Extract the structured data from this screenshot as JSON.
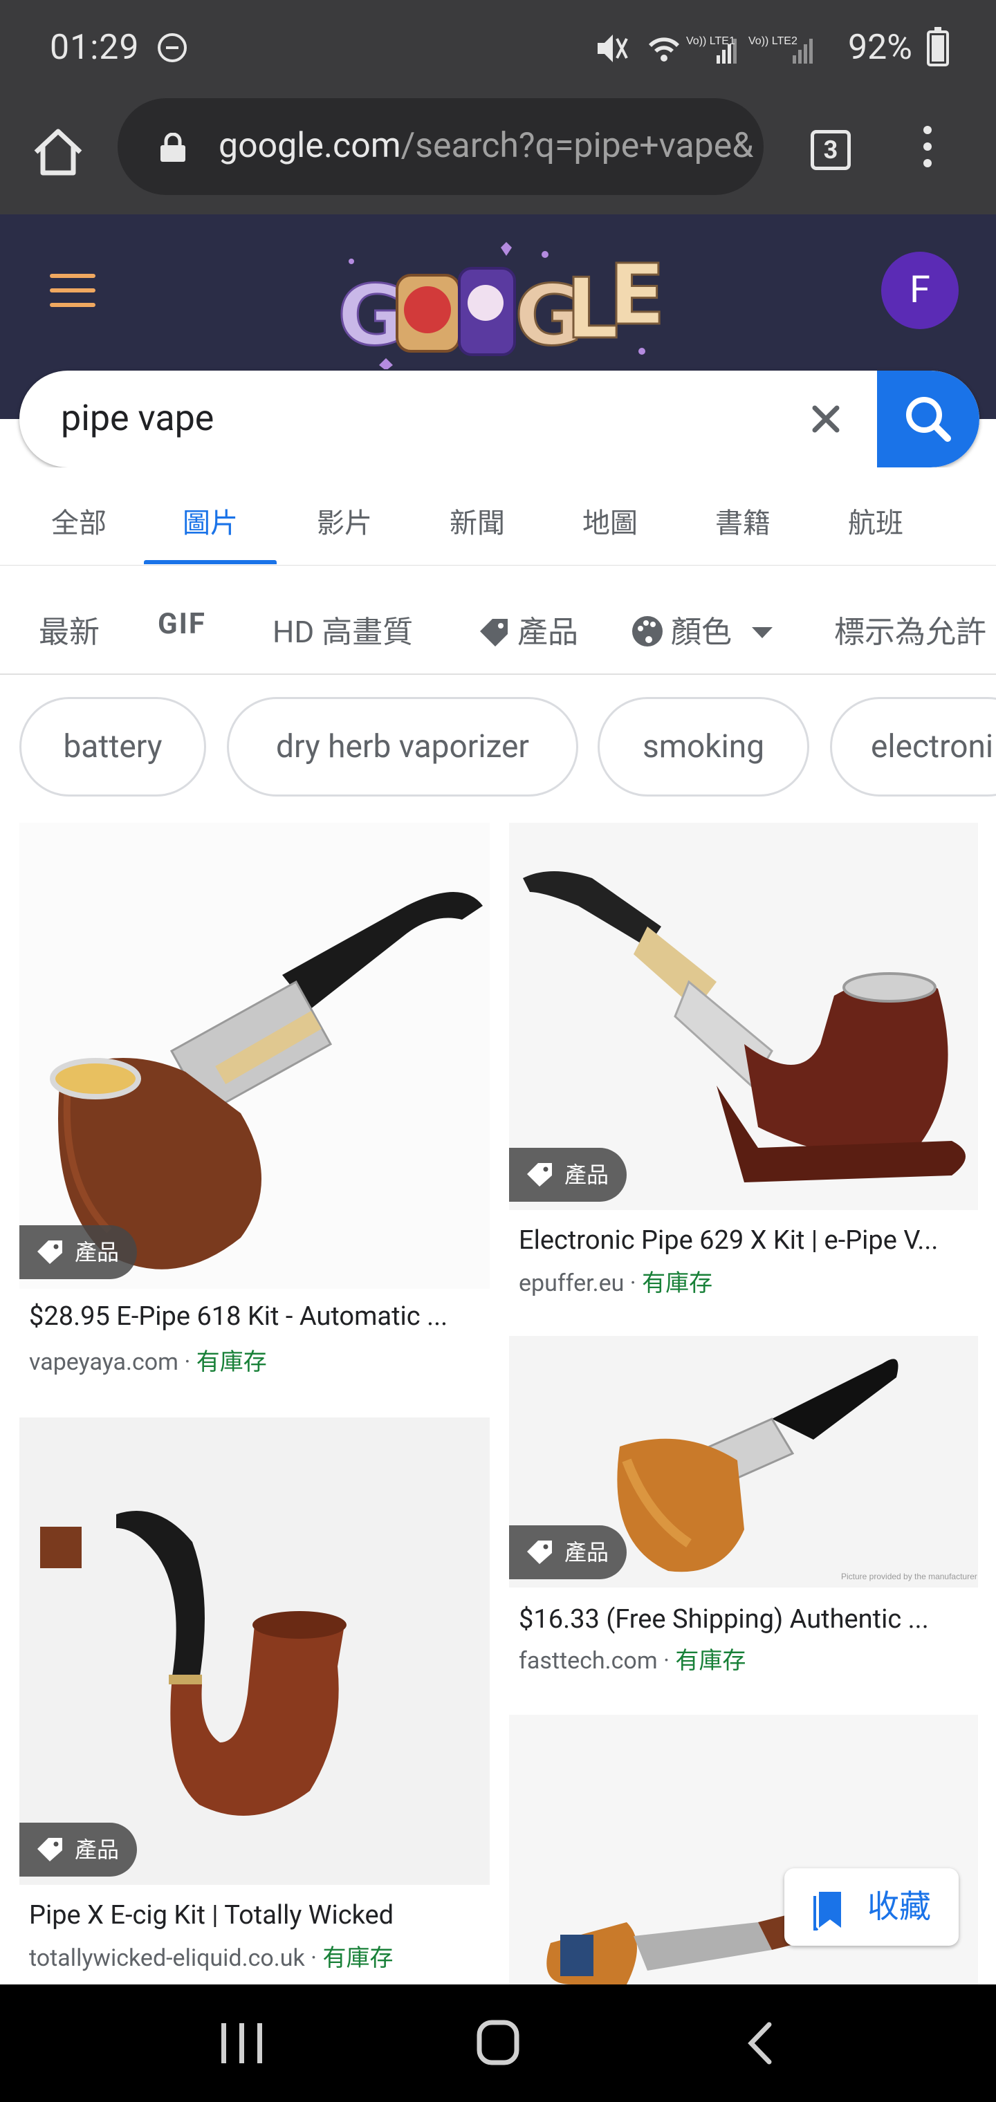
{
  "status_bar": {
    "time": "01:29",
    "battery": "92%",
    "network_labels": [
      "Vo)) LTE1",
      "Vo)) LTE2"
    ]
  },
  "browser": {
    "url_host": "google.com",
    "url_rest": "/search?q=pipe+vape&",
    "tab_count": "3"
  },
  "header": {
    "avatar_letter": "F",
    "colors": {
      "header_bg": "#2b2d47",
      "avatar_bg": "#5b2bb5",
      "accent": "#1a73e8"
    }
  },
  "search": {
    "query": "pipe vape"
  },
  "nav_tabs": [
    {
      "label": "全部"
    },
    {
      "label": "圖片"
    },
    {
      "label": "影片"
    },
    {
      "label": "新聞"
    },
    {
      "label": "地圖"
    },
    {
      "label": "書籍"
    },
    {
      "label": "航班"
    }
  ],
  "tools": {
    "latest": "最新",
    "gif": "GIF",
    "hd": "HD 高畫質",
    "products": "產品",
    "color": "顏色",
    "license": "標示為允許"
  },
  "chips": [
    "battery",
    "dry herb vaporizer",
    "smoking",
    "electroni"
  ],
  "results": [
    {
      "badge": "產品",
      "title": "$28.95 E-Pipe 618 Kit - Automatic ...",
      "source": "vapeyaya.com",
      "stock": "有庫存"
    },
    {
      "badge": "產品",
      "title": "Electronic Pipe 629 X Kit | e-Pipe V...",
      "source": "epuffer.eu",
      "stock": "有庫存"
    },
    {
      "badge": "產品",
      "title": "Pipe X E-cig Kit | Totally Wicked",
      "source": "totallywicked-eliquid.co.uk",
      "stock": "有庫存"
    },
    {
      "badge": "產品",
      "title": "$16.33 (Free Shipping) Authentic ...",
      "source": "fasttech.com",
      "stock": "有庫存",
      "watermark": "Picture provided by the manufacturer"
    }
  ],
  "save_button": {
    "label": "收藏"
  },
  "source_separator": "·"
}
